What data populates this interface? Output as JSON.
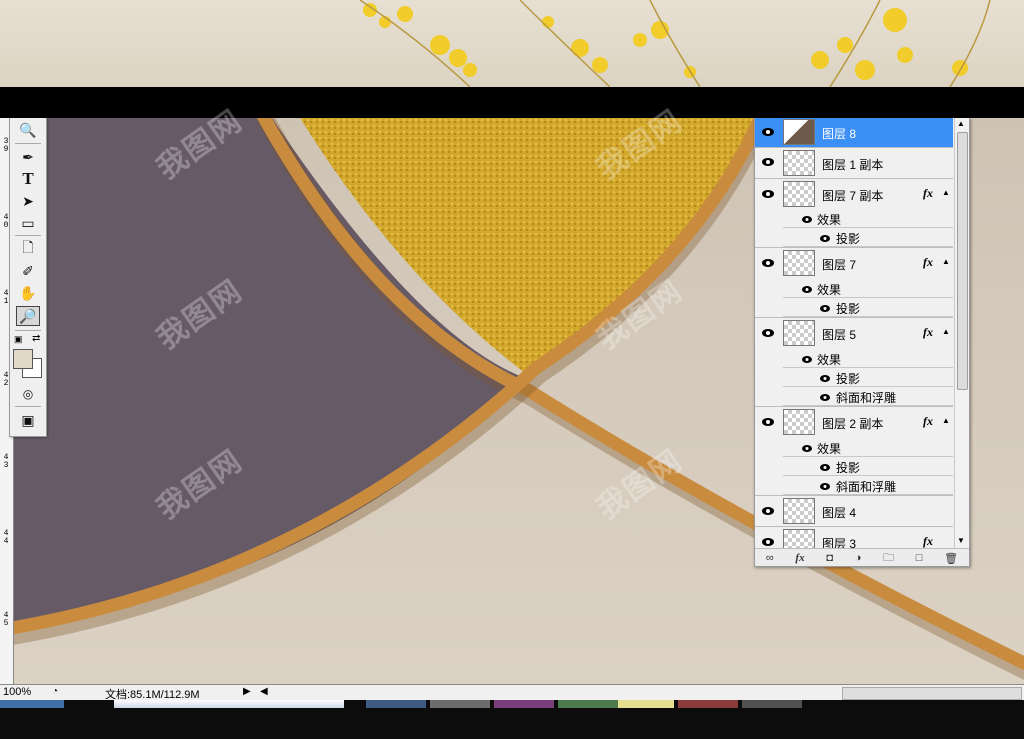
{
  "ruler": {
    "labels": [
      "3\n9",
      "4\n0",
      "4\n1",
      "4\n2",
      "4\n3",
      "4\n4",
      "4\n5"
    ]
  },
  "toolbox": {
    "tools": [
      "magnifier-icon",
      "pen-icon",
      "type-icon",
      "arrow-select-icon",
      "rectangle-shape-icon",
      "notes-icon",
      "eyedropper-icon",
      "hand-icon",
      "zoom-icon"
    ],
    "type_glyph": "T",
    "foreground_color": "#e3d9c9",
    "background_color": "#ffffff"
  },
  "layers": [
    {
      "name": "图层 8",
      "selected": true,
      "has_fx": false
    },
    {
      "name": "图层 1 副本",
      "selected": false,
      "has_fx": false
    },
    {
      "name": "图层 7 副本",
      "selected": false,
      "has_fx": true,
      "effects_label": "效果",
      "effects": [
        "投影"
      ]
    },
    {
      "name": "图层 7",
      "selected": false,
      "has_fx": true,
      "effects_label": "效果",
      "effects": [
        "投影"
      ]
    },
    {
      "name": "图层 5",
      "selected": false,
      "has_fx": true,
      "effects_label": "效果",
      "effects": [
        "投影",
        "斜面和浮雕"
      ]
    },
    {
      "name": "图层 2 副本",
      "selected": false,
      "has_fx": true,
      "effects_label": "效果",
      "effects": [
        "投影",
        "斜面和浮雕"
      ]
    },
    {
      "name": "图层 4",
      "selected": false,
      "has_fx": false
    },
    {
      "name": "图层 3",
      "selected": false,
      "has_fx": true
    }
  ],
  "fx_label": "fx",
  "status": {
    "zoom": "100%",
    "doc": "文档:85.1M/112.9M"
  },
  "watermark": "我图网",
  "colors": {
    "purple_panel": "#675a67",
    "gold_texture": "#d3a92b",
    "frame": "#c98c3f",
    "wall": "#d9cebf",
    "selection": "#3c8ff4"
  }
}
